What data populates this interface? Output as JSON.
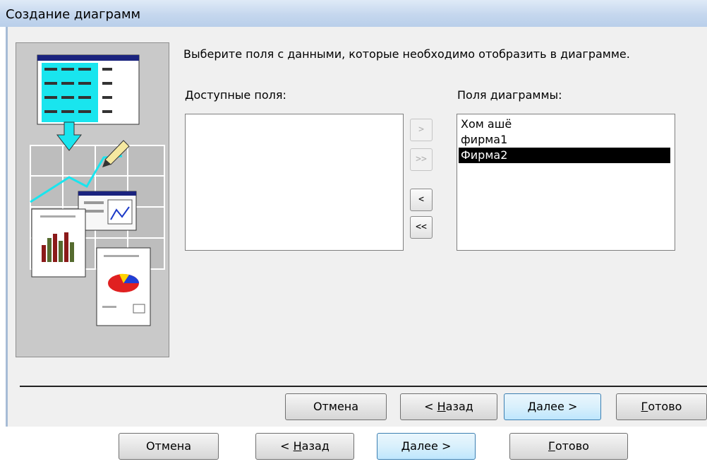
{
  "window": {
    "title": "Создание диаграмм"
  },
  "instruction": "Выберите поля с данными, которые необходимо отобразить в диаграмме.",
  "available": {
    "label": "Доступные поля:",
    "items": []
  },
  "chart_fields": {
    "label": "Поля диаграммы:",
    "items": [
      "Хом ашё",
      "фирма1",
      "Фирма2"
    ],
    "selected_index": 2
  },
  "move_buttons": {
    "add_one": ">",
    "add_all": ">>",
    "remove_one": "<",
    "remove_all": "<<"
  },
  "buttons": {
    "cancel": "Отмена",
    "back_prefix": "< ",
    "back_hotkey": "Н",
    "back_rest": "азад",
    "next_hotkey": "Д",
    "next_rest": "алее >",
    "finish_hotkey": "Г",
    "finish_rest": "отово"
  },
  "colors": {
    "title_bar": "#c5d7ee",
    "dialog_bg": "#f0f0f0",
    "illustration_bg": "#c9c9c9",
    "selection": "#000000",
    "default_button_border": "#3c7fb1"
  },
  "icons": [
    "chart-wizard-illustration"
  ]
}
